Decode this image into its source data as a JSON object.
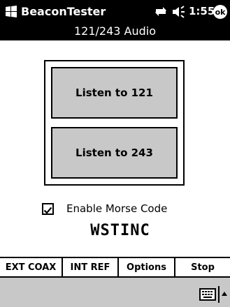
{
  "titlebar": {
    "app_title": "BeaconTester",
    "clock": "1:55",
    "ok_label": "ok"
  },
  "subtitle": "121/243 Audio",
  "buttons": {
    "listen121": "Listen to 121",
    "listen243": "Listen to 243"
  },
  "morse": {
    "checkbox_label": "Enable Morse Code",
    "checked": true,
    "code_text": "WSTINC"
  },
  "bottom_bar": {
    "items": [
      "EXT COAX",
      "INT REF",
      "Options",
      "Stop"
    ]
  },
  "colors": {
    "titlebar_bg": "#000000",
    "button_face": "#c8c8c8",
    "sip_bar": "#c8c8c8"
  }
}
